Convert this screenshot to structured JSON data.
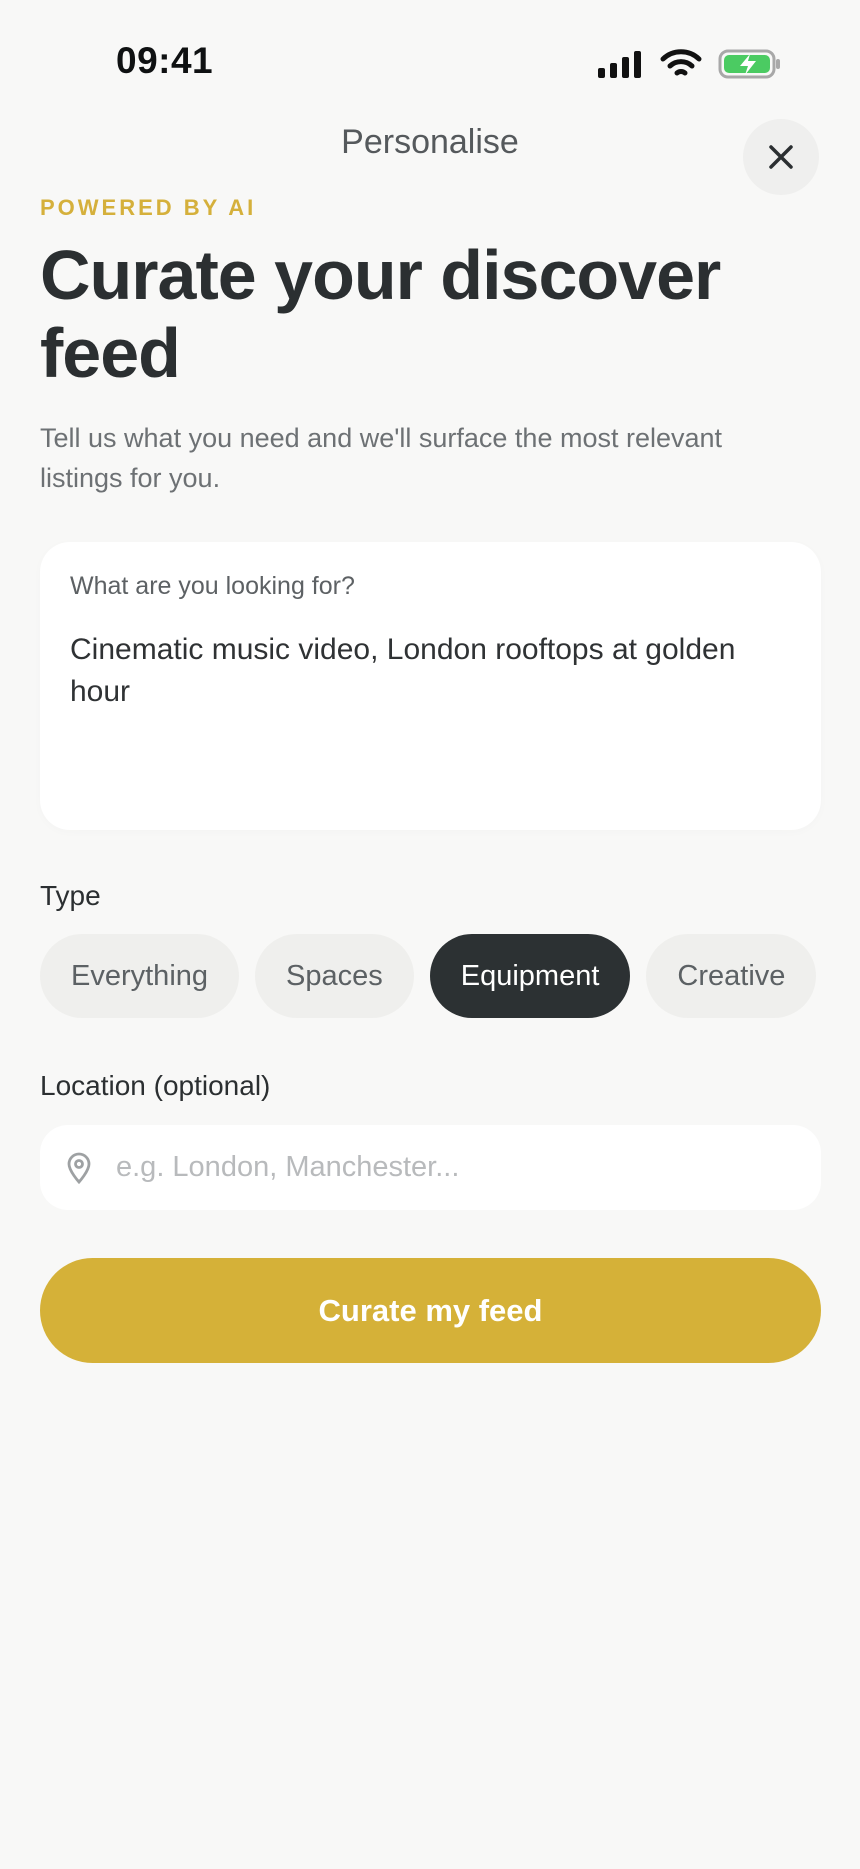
{
  "status_bar": {
    "time": "09:41"
  },
  "header": {
    "title": "Personalise",
    "close_icon": "close-icon"
  },
  "hero": {
    "eyebrow": "POWERED BY AI",
    "title": "Curate your discover feed",
    "subtitle": "Tell us what you need and we'll surface the most relevant listings for you."
  },
  "query": {
    "label": "What are you looking for?",
    "value": "Cinematic music video, London rooftops at golden hour"
  },
  "type": {
    "label": "Type",
    "chips": [
      {
        "label": "Everything",
        "selected": false
      },
      {
        "label": "Spaces",
        "selected": false
      },
      {
        "label": "Equipment",
        "selected": true
      },
      {
        "label": "Creative",
        "selected": false
      }
    ]
  },
  "location": {
    "label": "Location (optional)",
    "placeholder": "e.g. London, Manchester...",
    "value": "",
    "icon": "location-pin-icon"
  },
  "actions": {
    "submit_label": "Curate my feed"
  },
  "colors": {
    "accent": "#D5B138",
    "dark_chip": "#2C3133",
    "background": "#F8F8F7",
    "battery": "#4BCB62"
  }
}
